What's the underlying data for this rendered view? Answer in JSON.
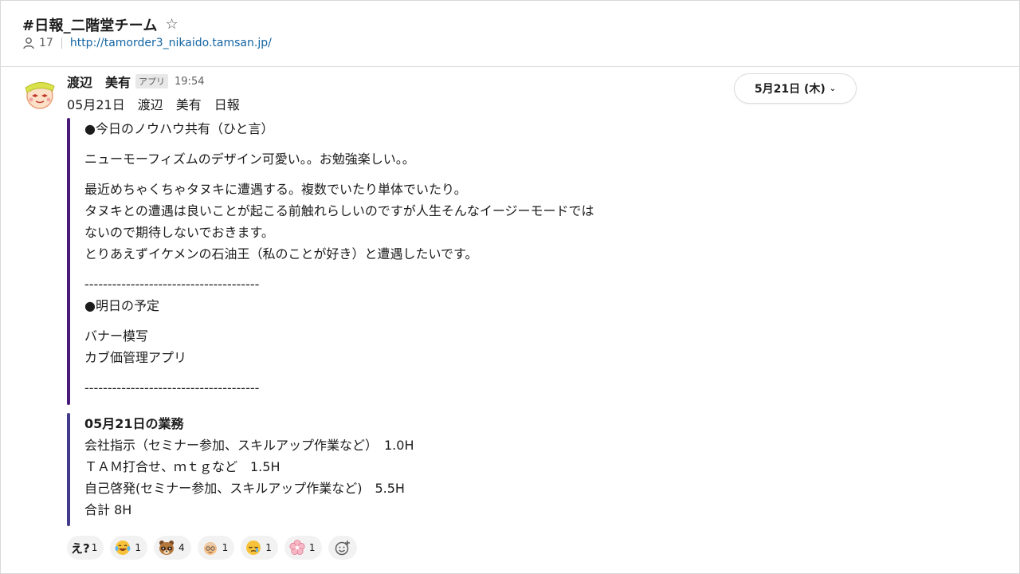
{
  "channel": {
    "name": "#日報_二階堂チーム",
    "star_icon": "☆",
    "member_count": "17",
    "link": "http://tamorder3_nikaido.tamsan.jp/"
  },
  "date_pill": {
    "label": "5月21日 (木)",
    "chevron": "⌄"
  },
  "message": {
    "sender": "渡辺　美有",
    "badge": "アプリ",
    "time": "19:54",
    "first_line": "05月21日　渡辺　美有　日報"
  },
  "attachment1": {
    "lines": [
      "●今日のノウハウ共有（ひと言）",
      "ニューモーフィズムのデザイン可愛い。。お勉強楽しい。。",
      "最近めちゃくちゃタヌキに遭遇する。複数でいたり単体でいたり。",
      "タヌキとの遭遇は良いことが起こる前触れらしいのですが人生そんなイージーモードでは",
      "ないので期待しないでおきます。",
      "とりあえずイケメンの石油王（私のことが好き）と遭遇したいです。",
      "--------------------------------------",
      "●明日の予定",
      "バナー模写",
      "カブ価管理アプリ",
      "--------------------------------------"
    ]
  },
  "attachment2": {
    "title": "05月21日の業務",
    "lines": [
      "会社指示（セミナー参加、スキルアップ作業など）　1.0H",
      "ＴＡＭ打合せ、ｍｔｇなど　1.5H",
      "自己啓発(セミナー参加、スキルアップ作業など)　5.5H",
      "合計 8H"
    ]
  },
  "reactions": [
    {
      "icon": "e-question-text-emoji",
      "glyph": "え?",
      "count": "1"
    },
    {
      "icon": "laughing-tears-emoji",
      "count": "1"
    },
    {
      "icon": "tanuki-emoji",
      "count": "4"
    },
    {
      "icon": "older-person-emoji",
      "count": "1"
    },
    {
      "icon": "sleepy-face-emoji",
      "count": "1"
    },
    {
      "icon": "sakura-flower-emoji",
      "count": "1"
    }
  ],
  "add_reaction_icon": "add-emoji-icon"
}
